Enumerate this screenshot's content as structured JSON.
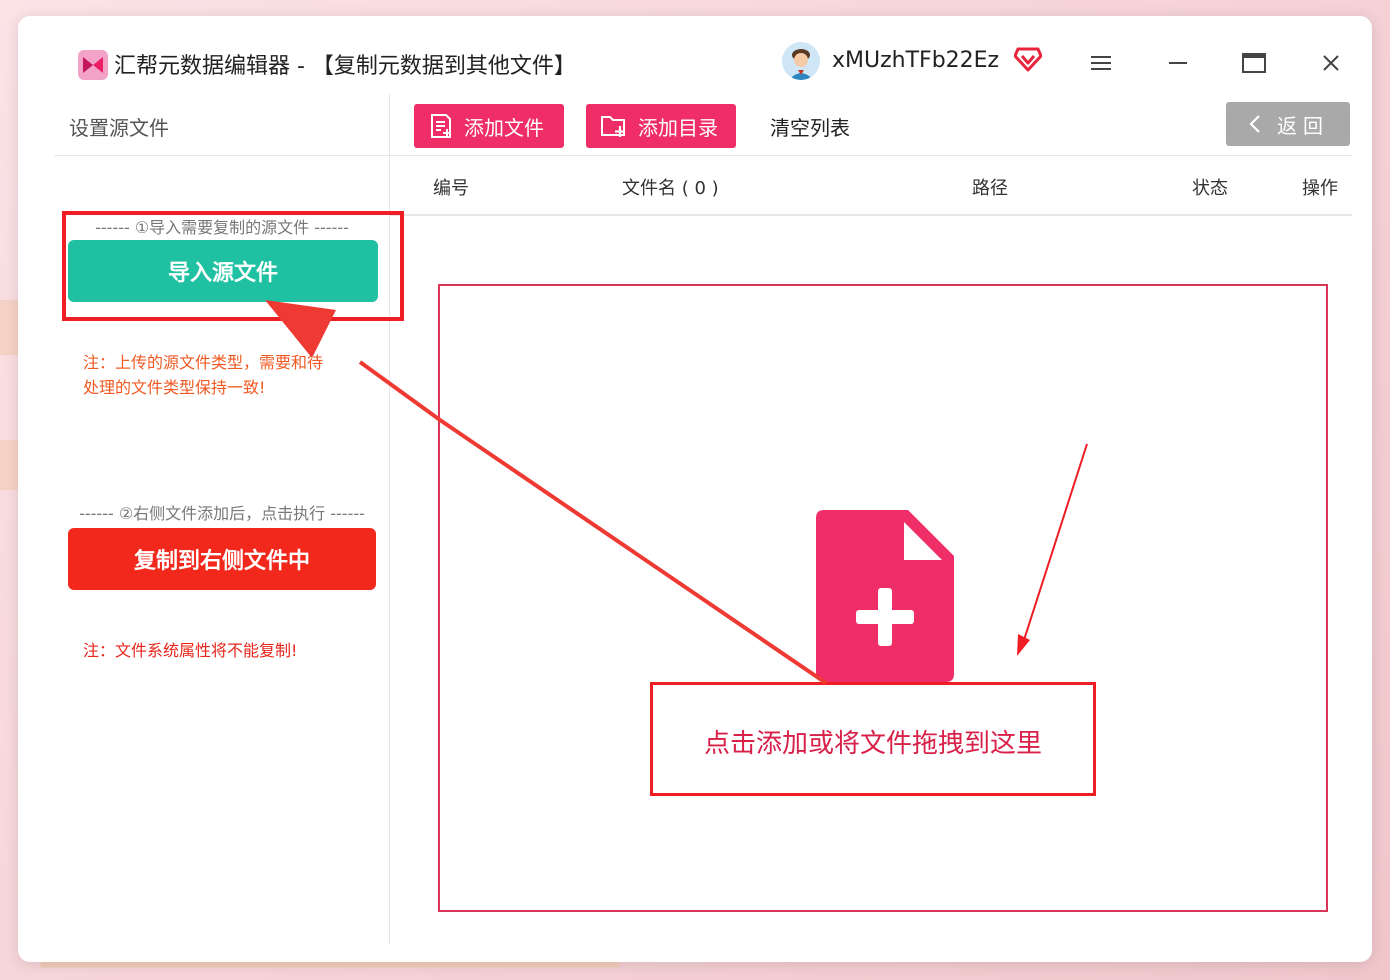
{
  "window": {
    "title": "汇帮元数据编辑器 - 【复制元数据到其他文件】",
    "username": "xMUzhTFb22Ez"
  },
  "left_panel": {
    "header": "设置源文件",
    "step1": "------ ①导入需要复制的源文件 ------",
    "import_button": "导入源文件",
    "note1_line1": "注：上传的源文件类型，需要和待",
    "note1_line2": "处理的文件类型保持一致!",
    "step2": "------ ②右侧文件添加后，点击执行 ------",
    "copy_button": "复制到右侧文件中",
    "note2": "注：文件系统属性将不能复制!"
  },
  "toolbar": {
    "add_file": "添加文件",
    "add_dir": "添加目录",
    "clear_list": "清空列表",
    "back": "返回"
  },
  "table": {
    "columns": [
      "编号",
      "文件名 ( 0 )",
      "路径",
      "状态",
      "操作"
    ]
  },
  "drop_zone": {
    "text": "点击添加或将文件拖拽到这里"
  },
  "colors": {
    "accent_pink": "#ef2d66",
    "import_teal": "#20c1a2",
    "copy_red": "#f2281c",
    "note_orange": "#f05a24",
    "annotation_red": "#ee1e24"
  },
  "icons": [
    "app-logo-icon",
    "avatar-icon",
    "vip-diamond-icon",
    "menu-icon",
    "minimize-icon",
    "maximize-icon",
    "close-icon",
    "add-file-icon",
    "add-folder-icon",
    "chevron-left-icon",
    "file-plus-icon"
  ]
}
